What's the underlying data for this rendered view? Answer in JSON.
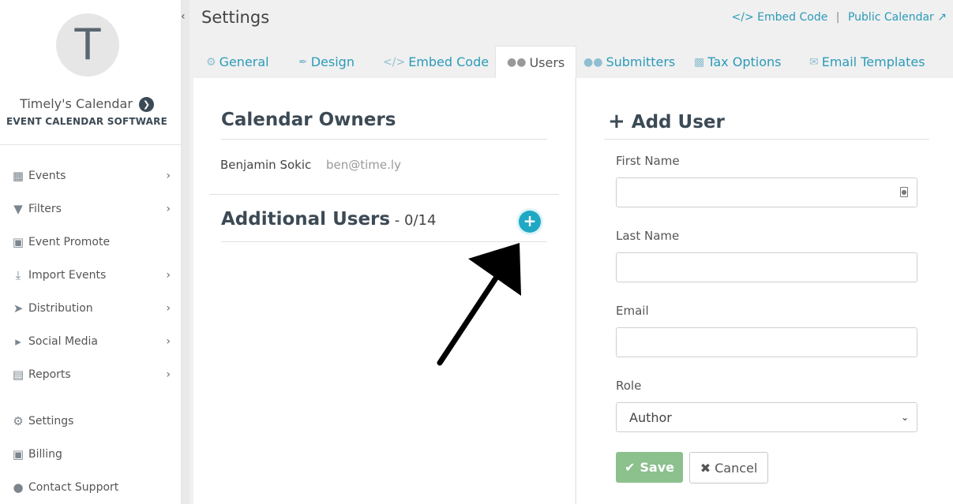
{
  "sidebar": {
    "avatar_letter": "T",
    "calendar_name": "Timely's Calendar",
    "calendar_subtitle": "EVENT CALENDAR SOFTWARE",
    "items": [
      {
        "label": "Events",
        "icon": "calendar-icon",
        "has_submenu": true
      },
      {
        "label": "Filters",
        "icon": "filter-icon",
        "has_submenu": true
      },
      {
        "label": "Event Promote",
        "icon": "cart-icon",
        "has_submenu": false
      },
      {
        "label": "Import Events",
        "icon": "download-icon",
        "has_submenu": true
      },
      {
        "label": "Distribution",
        "icon": "paper-plane-icon",
        "has_submenu": true
      },
      {
        "label": "Social Media",
        "icon": "megaphone-icon",
        "has_submenu": true
      },
      {
        "label": "Reports",
        "icon": "report-icon",
        "has_submenu": true
      },
      {
        "label": "Settings",
        "icon": "gears-icon",
        "has_submenu": false
      },
      {
        "label": "Billing",
        "icon": "cart-icon",
        "has_submenu": false
      },
      {
        "label": "Contact Support",
        "icon": "support-agent-icon",
        "has_submenu": false
      }
    ]
  },
  "header": {
    "title": "Settings",
    "embed_code_link": "Embed Code",
    "separator": "|",
    "public_calendar_link": "Public Calendar"
  },
  "tabs": [
    {
      "label": "General",
      "icon": "gears-icon"
    },
    {
      "label": "Design",
      "icon": "brush-icon"
    },
    {
      "label": "Embed Code",
      "icon": "code-icon"
    },
    {
      "label": "Users",
      "icon": "users-icon",
      "active": true
    },
    {
      "label": "Submitters",
      "icon": "users-icon"
    },
    {
      "label": "Tax Options",
      "icon": "money-icon"
    },
    {
      "label": "Email Templates",
      "icon": "envelope-icon"
    }
  ],
  "owners": {
    "heading": "Calendar Owners",
    "name": "Benjamin Sokic",
    "email": "ben@time.ly"
  },
  "additional_users": {
    "heading": "Additional Users",
    "count": " - 0/14"
  },
  "add_user": {
    "heading": "Add User",
    "first_name_label": "First Name",
    "first_name_value": "",
    "last_name_label": "Last Name",
    "last_name_value": "",
    "email_label": "Email",
    "email_value": "",
    "role_label": "Role",
    "role_value": "Author",
    "save_label": "Save",
    "cancel_label": "Cancel"
  },
  "colors": {
    "accent": "#1fa8c4",
    "link": "#2b9bb8",
    "save_button": "#8cc08d",
    "heading": "#3c4a55"
  }
}
